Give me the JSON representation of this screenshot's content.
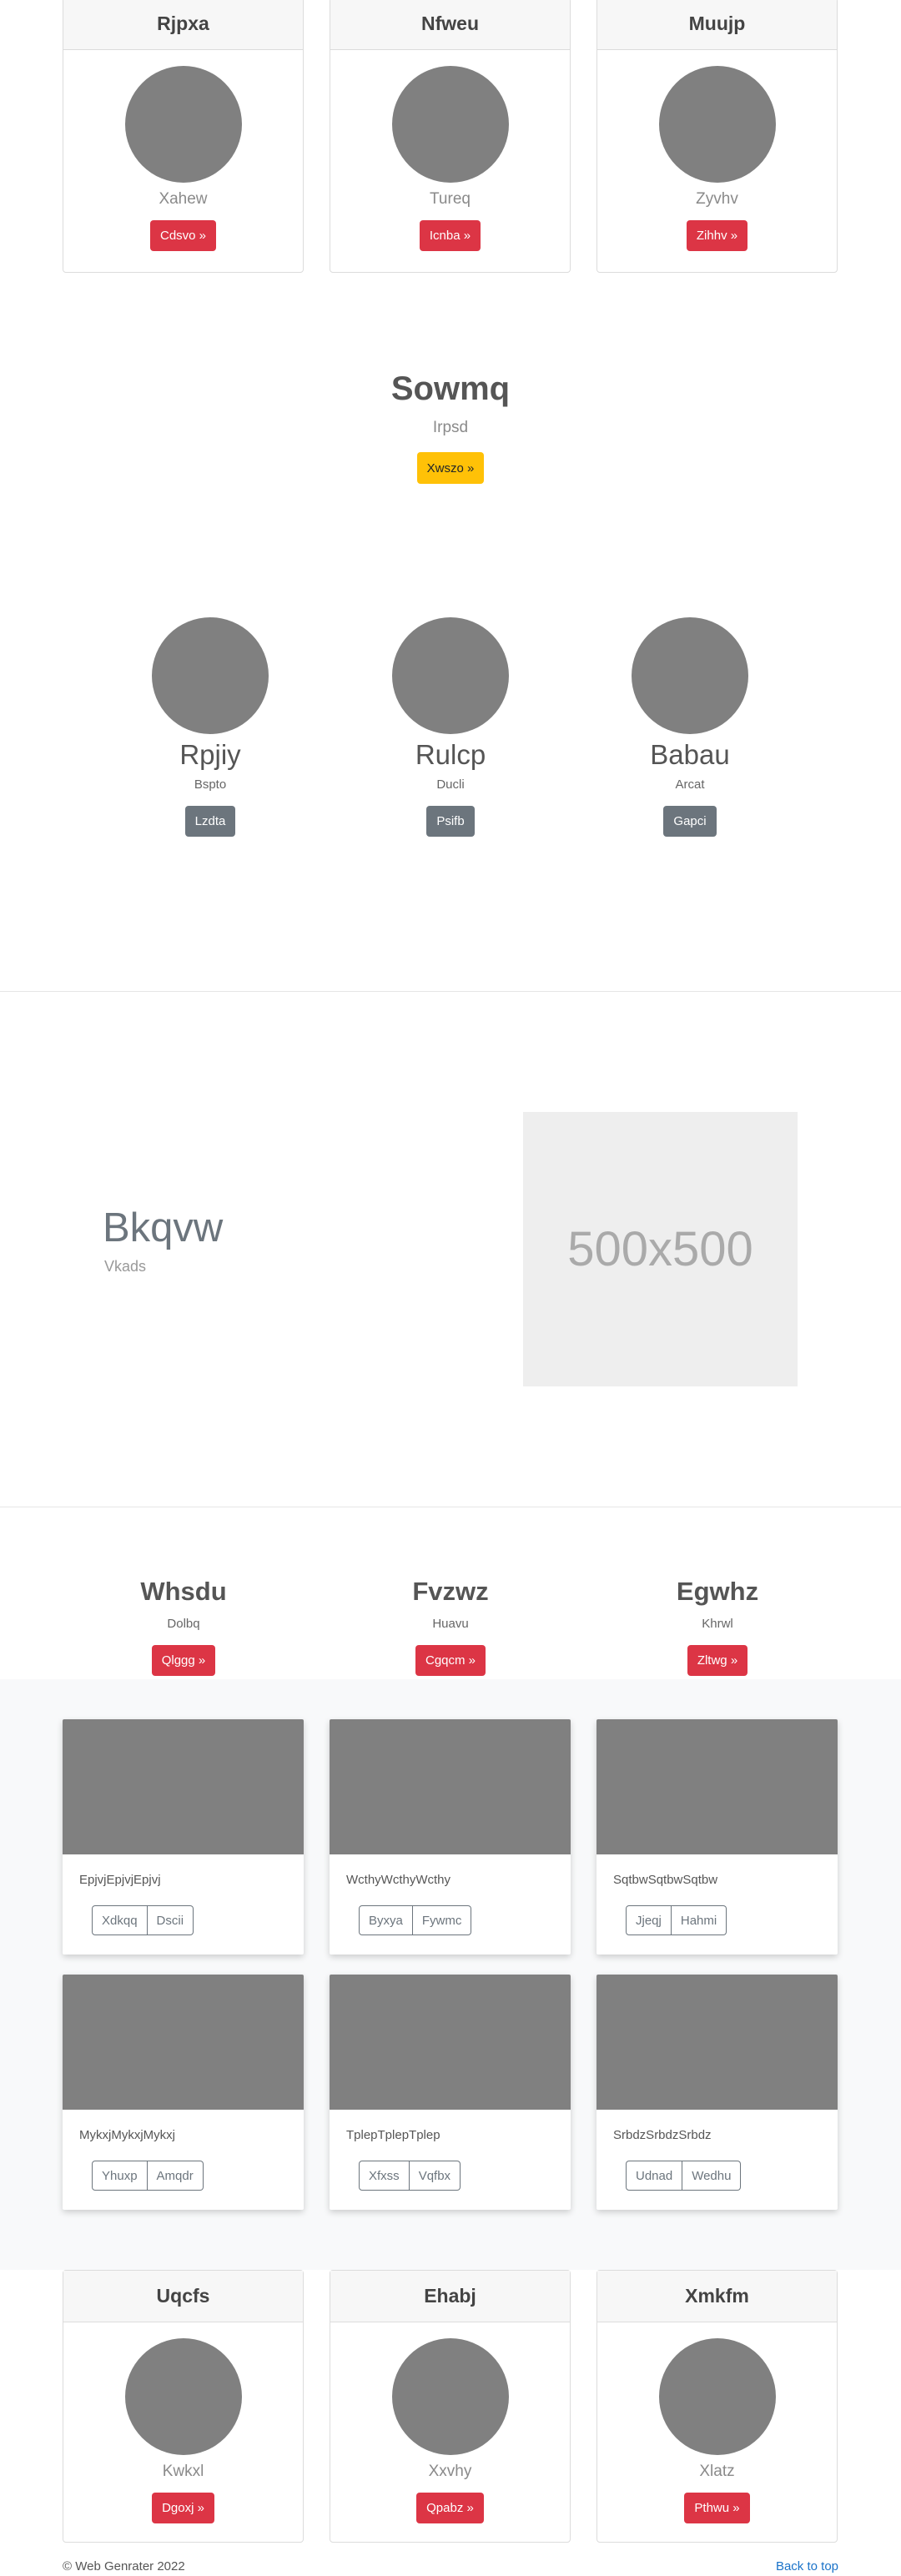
{
  "top_cards": [
    {
      "title": "Rjpxa",
      "subtitle": "Xahew",
      "button": "Cdsvo »"
    },
    {
      "title": "Nfweu",
      "subtitle": "Tureq",
      "button": "Icnba »"
    },
    {
      "title": "Muujp",
      "subtitle": "Zyvhv",
      "button": "Zihhv »"
    }
  ],
  "hero": {
    "title": "Sowmq",
    "subtitle": "Irpsd",
    "button": "Xwszo »"
  },
  "team": [
    {
      "name": "Rpjiy",
      "sub": "Bspto",
      "button": "Lzdta"
    },
    {
      "name": "Rulcp",
      "sub": "Ducli",
      "button": "Psifb"
    },
    {
      "name": "Babau",
      "sub": "Arcat",
      "button": "Gapci"
    }
  ],
  "feature": {
    "title": "Bkqvw",
    "subtitle": "Vkads",
    "image_text": "500x500"
  },
  "columns": [
    {
      "title": "Whsdu",
      "sub": "Dolbq",
      "button": "Qlggg »"
    },
    {
      "title": "Fvzwz",
      "sub": "Huavu",
      "button": "Cgqcm »"
    },
    {
      "title": "Egwhz",
      "sub": "Khrwl",
      "button": "Zltwg »"
    }
  ],
  "gallery": [
    {
      "text": "EpjvjEpjvjEpjvj",
      "b1": "Xdkqq",
      "b2": "Dscii"
    },
    {
      "text": "WcthyWcthyWcthy",
      "b1": "Byxya",
      "b2": "Fywmc"
    },
    {
      "text": "SqtbwSqtbwSqtbw",
      "b1": "Jjeqj",
      "b2": "Hahmi"
    },
    {
      "text": "MykxjMykxjMykxj",
      "b1": "Yhuxp",
      "b2": "Amqdr"
    },
    {
      "text": "TplepTplepTplep",
      "b1": "Xfxss",
      "b2": "Vqfbx"
    },
    {
      "text": "SrbdzSrbdzSrbdz",
      "b1": "Udnad",
      "b2": "Wedhu"
    }
  ],
  "bottom_cards": [
    {
      "title": "Uqcfs",
      "subtitle": "Kwkxl",
      "button": "Dgoxj »"
    },
    {
      "title": "Ehabj",
      "subtitle": "Xxvhy",
      "button": "Qpabz »"
    },
    {
      "title": "Xmkfm",
      "subtitle": "Xlatz",
      "button": "Pthwu »"
    }
  ],
  "footer": {
    "copyright": "© Web Genrater 2022",
    "back_to_top": "Back to top"
  }
}
